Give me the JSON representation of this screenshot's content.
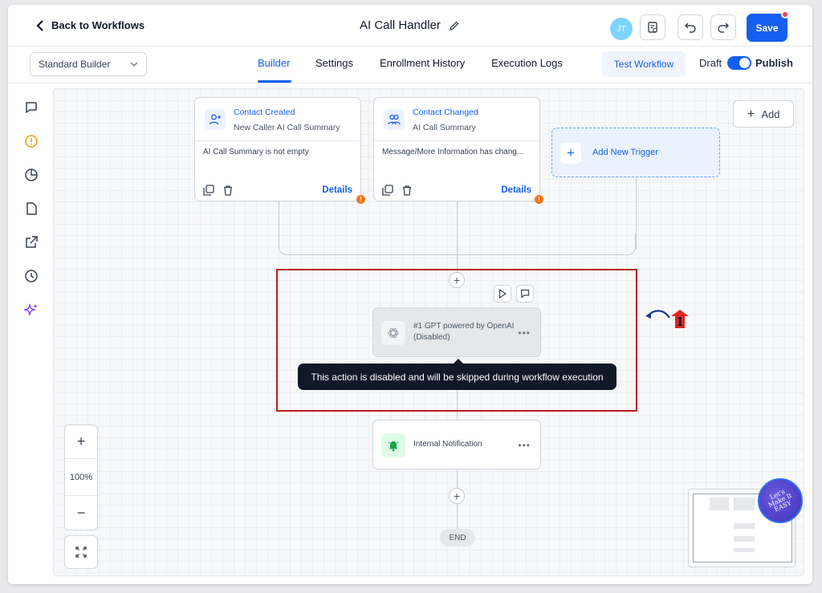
{
  "header": {
    "back_label": "Back to Workflows",
    "workflow_title": "AI Call Handler",
    "avatar_initials": "JT",
    "save_label": "Save"
  },
  "subheader": {
    "builder_select_value": "Standard Builder",
    "tabs": [
      {
        "label": "Builder",
        "active": true
      },
      {
        "label": "Settings",
        "active": false
      },
      {
        "label": "Enrollment History",
        "active": false
      },
      {
        "label": "Execution Logs",
        "active": false
      }
    ],
    "test_workflow_label": "Test Workflow",
    "draft_label": "Draft",
    "publish_label": "Publish",
    "publish_toggle_on": true
  },
  "sidebar": {
    "icons": [
      "comment-icon",
      "alert-circle-icon",
      "pie-chart-icon",
      "document-icon",
      "external-link-icon",
      "clock-icon",
      "sparkle-icon"
    ]
  },
  "canvas": {
    "add_label": "Add",
    "triggers": [
      {
        "name": "Contact Created",
        "subtitle": "New Caller AI Call Summary",
        "condition": "AI Call Summary is not empty",
        "details_label": "Details",
        "warning": "!"
      },
      {
        "name": "Contact Changed",
        "subtitle": "AI Call Summary",
        "condition": "Message/More Information has chang...",
        "details_label": "Details",
        "warning": "!"
      }
    ],
    "add_trigger_label": "Add New Trigger",
    "actions": [
      {
        "title": "#1 GPT powered by OpenAI",
        "status": "(Disabled)",
        "disabled": true
      },
      {
        "title": "Internal Notification",
        "status": "",
        "disabled": false
      }
    ],
    "tooltip": "This action is disabled and will be skipped during workflow execution",
    "end_label": "END",
    "zoom_level": "100%",
    "annotation_number": "1"
  },
  "badge": {
    "text": "Let's Make It EASY"
  },
  "colors": {
    "accent": "#155eef",
    "highlight_border": "#b91c1c",
    "warning": "#f97316",
    "notification_green": "#16a34a"
  }
}
